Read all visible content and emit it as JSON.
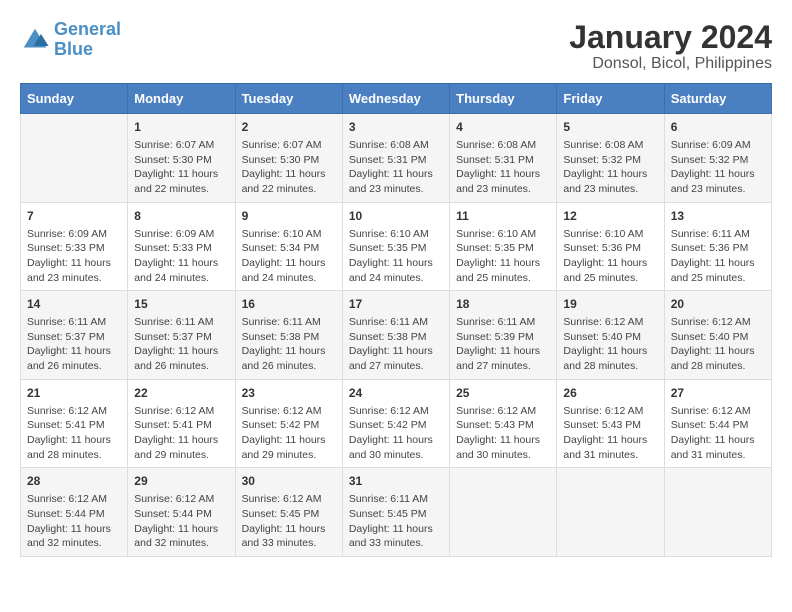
{
  "logo": {
    "text_general": "General",
    "text_blue": "Blue"
  },
  "title": "January 2024",
  "subtitle": "Donsol, Bicol, Philippines",
  "days_of_week": [
    "Sunday",
    "Monday",
    "Tuesday",
    "Wednesday",
    "Thursday",
    "Friday",
    "Saturday"
  ],
  "weeks": [
    [
      {
        "day": "",
        "info": ""
      },
      {
        "day": "1",
        "info": "Sunrise: 6:07 AM\nSunset: 5:30 PM\nDaylight: 11 hours\nand 22 minutes."
      },
      {
        "day": "2",
        "info": "Sunrise: 6:07 AM\nSunset: 5:30 PM\nDaylight: 11 hours\nand 22 minutes."
      },
      {
        "day": "3",
        "info": "Sunrise: 6:08 AM\nSunset: 5:31 PM\nDaylight: 11 hours\nand 23 minutes."
      },
      {
        "day": "4",
        "info": "Sunrise: 6:08 AM\nSunset: 5:31 PM\nDaylight: 11 hours\nand 23 minutes."
      },
      {
        "day": "5",
        "info": "Sunrise: 6:08 AM\nSunset: 5:32 PM\nDaylight: 11 hours\nand 23 minutes."
      },
      {
        "day": "6",
        "info": "Sunrise: 6:09 AM\nSunset: 5:32 PM\nDaylight: 11 hours\nand 23 minutes."
      }
    ],
    [
      {
        "day": "7",
        "info": "Sunrise: 6:09 AM\nSunset: 5:33 PM\nDaylight: 11 hours\nand 23 minutes."
      },
      {
        "day": "8",
        "info": "Sunrise: 6:09 AM\nSunset: 5:33 PM\nDaylight: 11 hours\nand 24 minutes."
      },
      {
        "day": "9",
        "info": "Sunrise: 6:10 AM\nSunset: 5:34 PM\nDaylight: 11 hours\nand 24 minutes."
      },
      {
        "day": "10",
        "info": "Sunrise: 6:10 AM\nSunset: 5:35 PM\nDaylight: 11 hours\nand 24 minutes."
      },
      {
        "day": "11",
        "info": "Sunrise: 6:10 AM\nSunset: 5:35 PM\nDaylight: 11 hours\nand 25 minutes."
      },
      {
        "day": "12",
        "info": "Sunrise: 6:10 AM\nSunset: 5:36 PM\nDaylight: 11 hours\nand 25 minutes."
      },
      {
        "day": "13",
        "info": "Sunrise: 6:11 AM\nSunset: 5:36 PM\nDaylight: 11 hours\nand 25 minutes."
      }
    ],
    [
      {
        "day": "14",
        "info": "Sunrise: 6:11 AM\nSunset: 5:37 PM\nDaylight: 11 hours\nand 26 minutes."
      },
      {
        "day": "15",
        "info": "Sunrise: 6:11 AM\nSunset: 5:37 PM\nDaylight: 11 hours\nand 26 minutes."
      },
      {
        "day": "16",
        "info": "Sunrise: 6:11 AM\nSunset: 5:38 PM\nDaylight: 11 hours\nand 26 minutes."
      },
      {
        "day": "17",
        "info": "Sunrise: 6:11 AM\nSunset: 5:38 PM\nDaylight: 11 hours\nand 27 minutes."
      },
      {
        "day": "18",
        "info": "Sunrise: 6:11 AM\nSunset: 5:39 PM\nDaylight: 11 hours\nand 27 minutes."
      },
      {
        "day": "19",
        "info": "Sunrise: 6:12 AM\nSunset: 5:40 PM\nDaylight: 11 hours\nand 28 minutes."
      },
      {
        "day": "20",
        "info": "Sunrise: 6:12 AM\nSunset: 5:40 PM\nDaylight: 11 hours\nand 28 minutes."
      }
    ],
    [
      {
        "day": "21",
        "info": "Sunrise: 6:12 AM\nSunset: 5:41 PM\nDaylight: 11 hours\nand 28 minutes."
      },
      {
        "day": "22",
        "info": "Sunrise: 6:12 AM\nSunset: 5:41 PM\nDaylight: 11 hours\nand 29 minutes."
      },
      {
        "day": "23",
        "info": "Sunrise: 6:12 AM\nSunset: 5:42 PM\nDaylight: 11 hours\nand 29 minutes."
      },
      {
        "day": "24",
        "info": "Sunrise: 6:12 AM\nSunset: 5:42 PM\nDaylight: 11 hours\nand 30 minutes."
      },
      {
        "day": "25",
        "info": "Sunrise: 6:12 AM\nSunset: 5:43 PM\nDaylight: 11 hours\nand 30 minutes."
      },
      {
        "day": "26",
        "info": "Sunrise: 6:12 AM\nSunset: 5:43 PM\nDaylight: 11 hours\nand 31 minutes."
      },
      {
        "day": "27",
        "info": "Sunrise: 6:12 AM\nSunset: 5:44 PM\nDaylight: 11 hours\nand 31 minutes."
      }
    ],
    [
      {
        "day": "28",
        "info": "Sunrise: 6:12 AM\nSunset: 5:44 PM\nDaylight: 11 hours\nand 32 minutes."
      },
      {
        "day": "29",
        "info": "Sunrise: 6:12 AM\nSunset: 5:44 PM\nDaylight: 11 hours\nand 32 minutes."
      },
      {
        "day": "30",
        "info": "Sunrise: 6:12 AM\nSunset: 5:45 PM\nDaylight: 11 hours\nand 33 minutes."
      },
      {
        "day": "31",
        "info": "Sunrise: 6:11 AM\nSunset: 5:45 PM\nDaylight: 11 hours\nand 33 minutes."
      },
      {
        "day": "",
        "info": ""
      },
      {
        "day": "",
        "info": ""
      },
      {
        "day": "",
        "info": ""
      }
    ]
  ]
}
